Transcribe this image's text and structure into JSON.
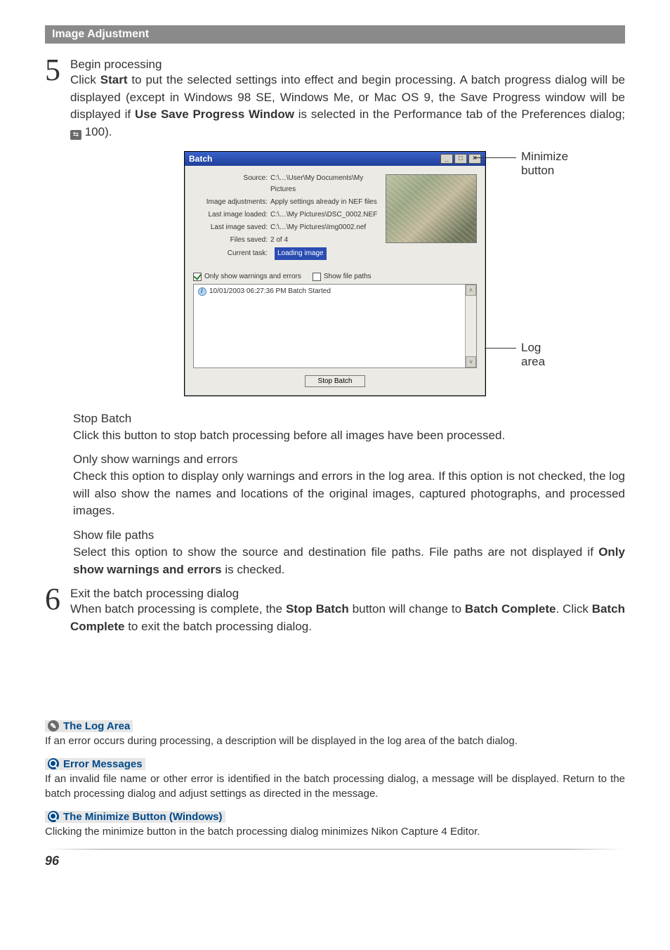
{
  "header": {
    "title": "Image Adjustment"
  },
  "step5": {
    "num": "5",
    "title": "Begin processing",
    "text_a": "Click ",
    "start": "Start",
    "text_b": " to put the selected settings into effect and begin processing. A batch progress dialog will be displayed (except in Windows 98 SE, Windows Me, or Mac OS 9, the Save Progress window will be displayed if ",
    "use_win": "Use Save Progress Window",
    "text_c": " is selected in the Performance tab of the Preferences dialog; ",
    "ref_icon": "⇆",
    "ref_page": " 100)."
  },
  "dialog": {
    "title": "Batch",
    "source_lab": "Source:",
    "source_val": "C:\\…\\User\\My Documents\\My Pictures",
    "adj_lab": "Image adjustments:",
    "adj_val": "Apply settings already in NEF files",
    "loaded_lab": "Last image loaded:",
    "loaded_val": "C:\\…\\My Pictures\\DSC_0002.NEF",
    "saved_lab": "Last image saved:",
    "saved_val": "C:\\…\\My Pictures\\Img0002.nef",
    "files_lab": "Files saved:",
    "files_val": "2 of 4",
    "task_lab": "Current task:",
    "task_val": "Loading image",
    "chk_warn": "Only show warnings and errors",
    "chk_paths": "Show file paths",
    "log_entry": "10/01/2003 06:27:36 PM  Batch Started",
    "stop_btn": "Stop Batch"
  },
  "callouts": {
    "minimize": "Minimize button",
    "logarea": "Log area"
  },
  "sections": {
    "stop_h": "Stop Batch",
    "stop_p": "Click this button to stop batch processing before all images have been processed.",
    "warn_h": "Only show warnings and errors",
    "warn_p": "Check this option to display only warnings and errors in the log area. If this option is not checked, the log will also show the names and locations of the original images, captured photographs, and processed images.",
    "paths_h": "Show file paths",
    "paths_p_a": "Select this option to show the source and destination file paths. File paths are not displayed if ",
    "paths_bold": "Only show warnings and errors",
    "paths_p_b": " is checked."
  },
  "step6": {
    "num": "6",
    "title": "Exit the batch processing dialog",
    "text_a": "When batch processing is complete, the ",
    "b1": "Stop Batch",
    "text_b": " button will change to ",
    "b2": "Batch Complete",
    "text_c": ". Click ",
    "b3": "Batch Complete",
    "text_d": " to exit the batch processing dialog."
  },
  "notes": {
    "log_h": "The Log Area",
    "log_p": "If an error occurs during processing, a description will be displayed in the log area of the batch dialog.",
    "err_h": "Error Messages",
    "err_p": "If an invalid file name or other error is identified in the batch processing dialog, a message will be displayed. Return to the batch processing dialog and adjust settings as directed in the message.",
    "min_h": "The Minimize Button (Windows)",
    "min_p": "Clicking the minimize button in the batch processing dialog minimizes Nikon Capture 4 Editor."
  },
  "footer": {
    "page": "96"
  }
}
